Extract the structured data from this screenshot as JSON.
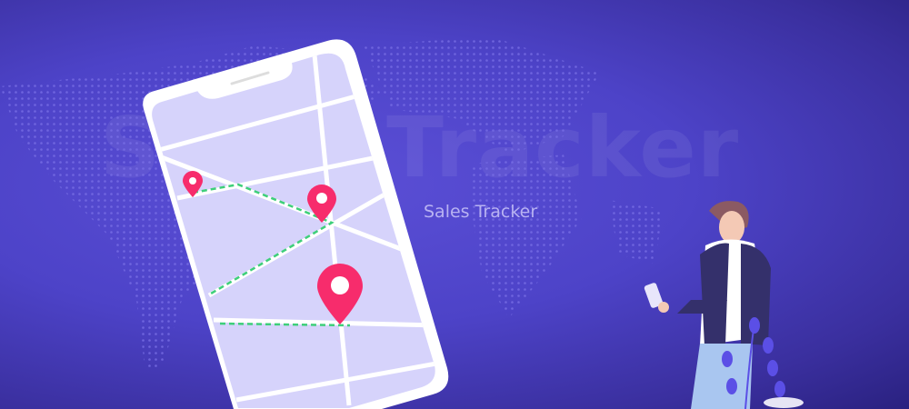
{
  "banner": {
    "watermark_text": "Sales Tracker",
    "subtitle": "Sales Tracker"
  },
  "colors": {
    "background": "#4d43c8",
    "map_screen": "#d6d3fb",
    "pin": "#f72c6c",
    "route": "#3ecf7a"
  }
}
